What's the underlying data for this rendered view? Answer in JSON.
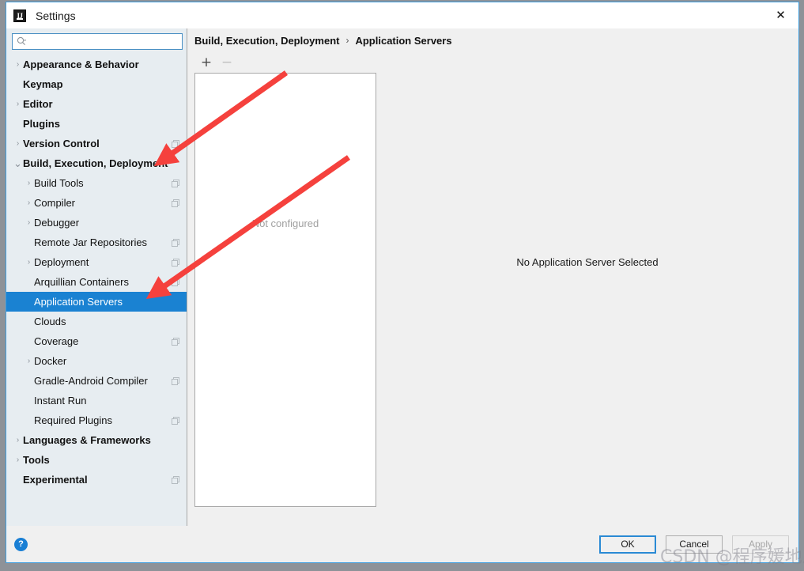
{
  "window": {
    "title": "Settings",
    "app_icon": "intellij-idea-icon",
    "close_icon": "close-icon"
  },
  "search": {
    "value": "",
    "placeholder": "",
    "icon": "search-icon"
  },
  "sidebar": {
    "items": [
      {
        "label": "Appearance & Behavior",
        "level": 0,
        "twisty": "collapsed",
        "module_icon": false,
        "selected": false
      },
      {
        "label": "Keymap",
        "level": 0,
        "twisty": "none",
        "module_icon": false,
        "selected": false
      },
      {
        "label": "Editor",
        "level": 0,
        "twisty": "collapsed",
        "module_icon": false,
        "selected": false
      },
      {
        "label": "Plugins",
        "level": 0,
        "twisty": "none",
        "module_icon": false,
        "selected": false
      },
      {
        "label": "Version Control",
        "level": 0,
        "twisty": "collapsed",
        "module_icon": true,
        "selected": false
      },
      {
        "label": "Build, Execution, Deployment",
        "level": 0,
        "twisty": "expanded",
        "module_icon": false,
        "selected": false
      },
      {
        "label": "Build Tools",
        "level": 1,
        "twisty": "collapsed",
        "module_icon": true,
        "selected": false
      },
      {
        "label": "Compiler",
        "level": 1,
        "twisty": "collapsed",
        "module_icon": true,
        "selected": false
      },
      {
        "label": "Debugger",
        "level": 1,
        "twisty": "collapsed",
        "module_icon": false,
        "selected": false
      },
      {
        "label": "Remote Jar Repositories",
        "level": 1,
        "twisty": "none",
        "module_icon": true,
        "selected": false
      },
      {
        "label": "Deployment",
        "level": 1,
        "twisty": "collapsed",
        "module_icon": true,
        "selected": false
      },
      {
        "label": "Arquillian Containers",
        "level": 1,
        "twisty": "none",
        "module_icon": true,
        "selected": false
      },
      {
        "label": "Application Servers",
        "level": 1,
        "twisty": "none",
        "module_icon": false,
        "selected": true
      },
      {
        "label": "Clouds",
        "level": 1,
        "twisty": "none",
        "module_icon": false,
        "selected": false
      },
      {
        "label": "Coverage",
        "level": 1,
        "twisty": "none",
        "module_icon": true,
        "selected": false
      },
      {
        "label": "Docker",
        "level": 1,
        "twisty": "collapsed",
        "module_icon": false,
        "selected": false
      },
      {
        "label": "Gradle-Android Compiler",
        "level": 1,
        "twisty": "none",
        "module_icon": true,
        "selected": false
      },
      {
        "label": "Instant Run",
        "level": 1,
        "twisty": "none",
        "module_icon": false,
        "selected": false
      },
      {
        "label": "Required Plugins",
        "level": 1,
        "twisty": "none",
        "module_icon": true,
        "selected": false
      },
      {
        "label": "Languages & Frameworks",
        "level": 0,
        "twisty": "collapsed",
        "module_icon": false,
        "selected": false
      },
      {
        "label": "Tools",
        "level": 0,
        "twisty": "collapsed",
        "module_icon": false,
        "selected": false
      },
      {
        "label": "Experimental",
        "level": 0,
        "twisty": "none",
        "module_icon": true,
        "selected": false
      }
    ]
  },
  "main": {
    "breadcrumb": {
      "parent": "Build, Execution, Deployment",
      "separator": "›",
      "current": "Application Servers"
    },
    "toolbar": {
      "add_label": "+",
      "remove_label": "−"
    },
    "list": {
      "empty_text": "Not configured"
    },
    "detail": {
      "empty_text": "No Application Server Selected"
    }
  },
  "footer": {
    "help_label": "?",
    "ok_label": "OK",
    "cancel_label": "Cancel",
    "apply_label": "Apply"
  },
  "watermark": {
    "text": "CSDN @程序媛地瓜"
  },
  "colors": {
    "selection": "#1a82d2",
    "accent_border": "#3f9ede",
    "sidebar_bg": "#e7edf1",
    "annotation_arrow": "#f5413d"
  }
}
